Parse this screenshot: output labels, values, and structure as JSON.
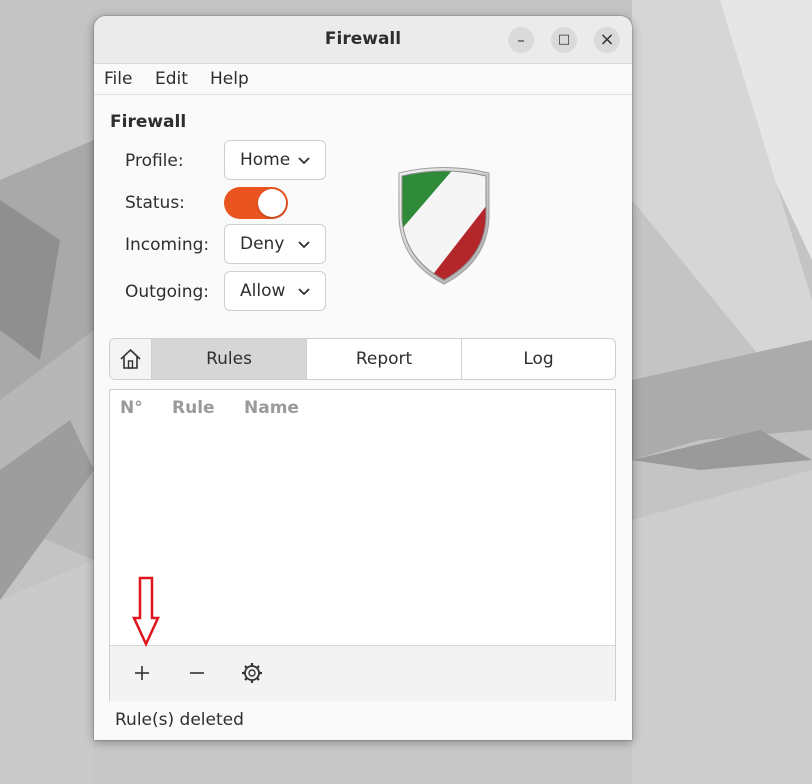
{
  "window": {
    "title": "Firewall",
    "controls": {
      "minimize": "–",
      "maximize": "□",
      "close": "×"
    }
  },
  "menu": {
    "file": "File",
    "edit": "Edit",
    "help": "Help"
  },
  "section": {
    "title": "Firewall"
  },
  "fields": {
    "profile": {
      "label": "Profile:",
      "value": "Home"
    },
    "status": {
      "label": "Status:",
      "enabled": true
    },
    "incoming": {
      "label": "Incoming:",
      "value": "Deny"
    },
    "outgoing": {
      "label": "Outgoing:",
      "value": "Allow"
    }
  },
  "tabs": {
    "home_icon": "home-icon",
    "rules": "Rules",
    "report": "Report",
    "log": "Log",
    "active": "Rules"
  },
  "rules_table": {
    "columns": [
      "N°",
      "Rule",
      "Name"
    ],
    "rows": []
  },
  "footer_buttons": {
    "add": "+",
    "remove": "−",
    "settings_icon": "gear-icon"
  },
  "statusbar": {
    "text": "Rule(s) deleted"
  },
  "colors": {
    "accent": "#e95420",
    "annotation_arrow": "#e0141e"
  }
}
